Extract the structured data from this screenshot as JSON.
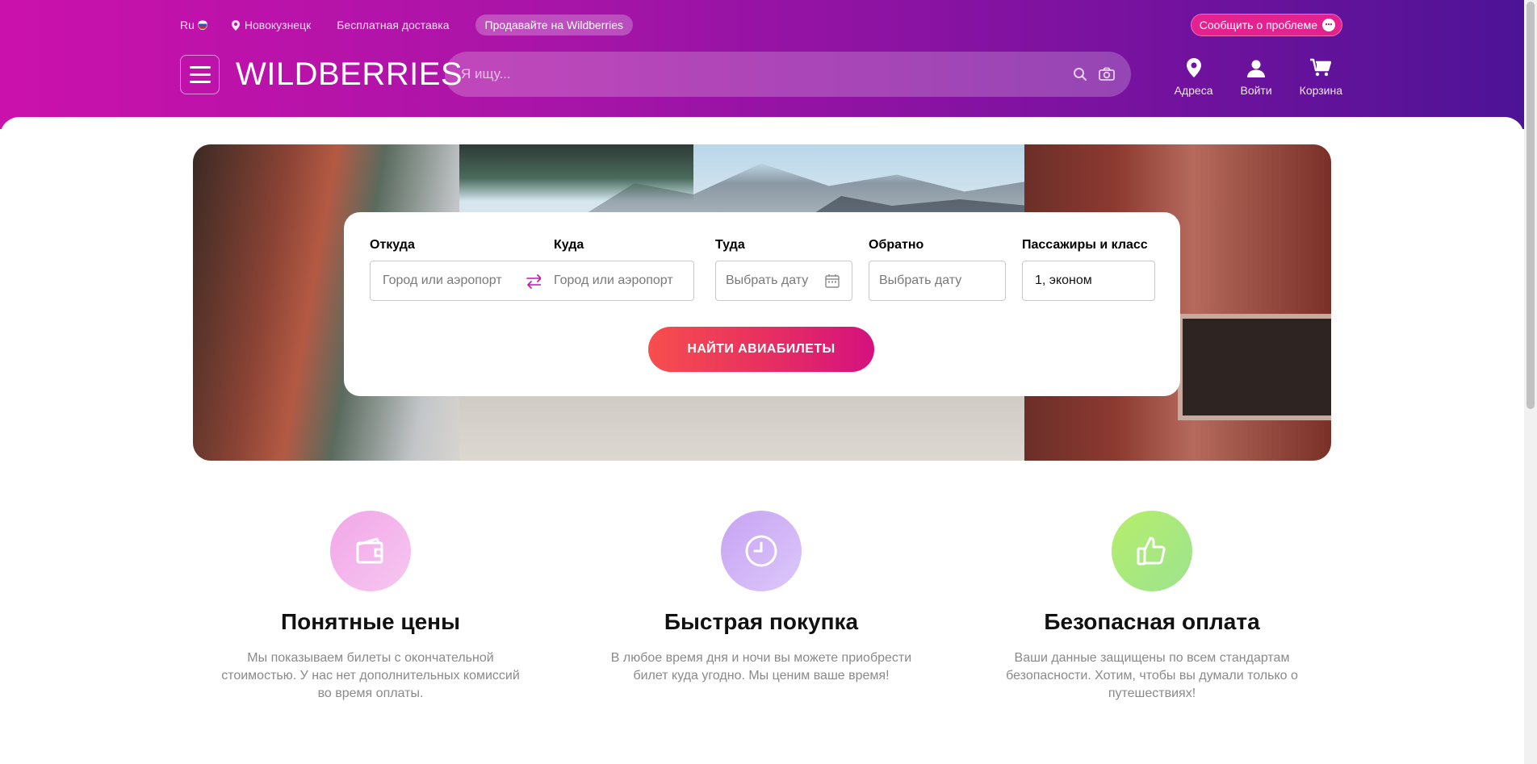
{
  "header": {
    "language": "Ru",
    "city": "Новокузнецк",
    "free_delivery": "Бесплатная доставка",
    "sell_button": "Продавайте на Wildberries",
    "report_button": "Сообщить о проблеме",
    "logo": "WILDBERRIES",
    "search_placeholder": "Я ищу...",
    "actions": [
      {
        "label": "Адреса",
        "icon": "location-pin-icon"
      },
      {
        "label": "Войти",
        "icon": "user-icon"
      },
      {
        "label": "Корзина",
        "icon": "cart-icon"
      }
    ]
  },
  "flight_search": {
    "from": {
      "label": "Откуда",
      "placeholder": "Город или аэропорт"
    },
    "to": {
      "label": "Куда",
      "placeholder": "Город или аэропорт"
    },
    "depart": {
      "label": "Туда",
      "placeholder": "Выбрать дату"
    },
    "return": {
      "label": "Обратно",
      "placeholder": "Выбрать дату"
    },
    "passengers": {
      "label": "Пассажиры и класс",
      "value": "1, эконом"
    },
    "submit": "НАЙТИ АВИАБИЛЕТЫ"
  },
  "features": [
    {
      "icon": "wallet-icon",
      "title": "Понятные цены",
      "text": "Мы показываем билеты с окончательной стоимостью. У нас нет дополнительных комиссий во время оплаты."
    },
    {
      "icon": "clock-icon",
      "title": "Быстрая покупка",
      "text": "В любое время дня и ночи вы можете приобрести билет куда угодно. Мы ценим ваше время!"
    },
    {
      "icon": "thumbs-up-icon",
      "title": "Безопасная оплата",
      "text": "Ваши данные защищены по всем стандартам безопасности. Хотим, чтобы вы думали только о путешествиях!"
    }
  ],
  "colors": {
    "brand_gradient_start": "#cb11ab",
    "brand_gradient_end": "#4b1396",
    "cta_gradient_start": "#f74e4e",
    "cta_gradient_end": "#d5117f"
  }
}
